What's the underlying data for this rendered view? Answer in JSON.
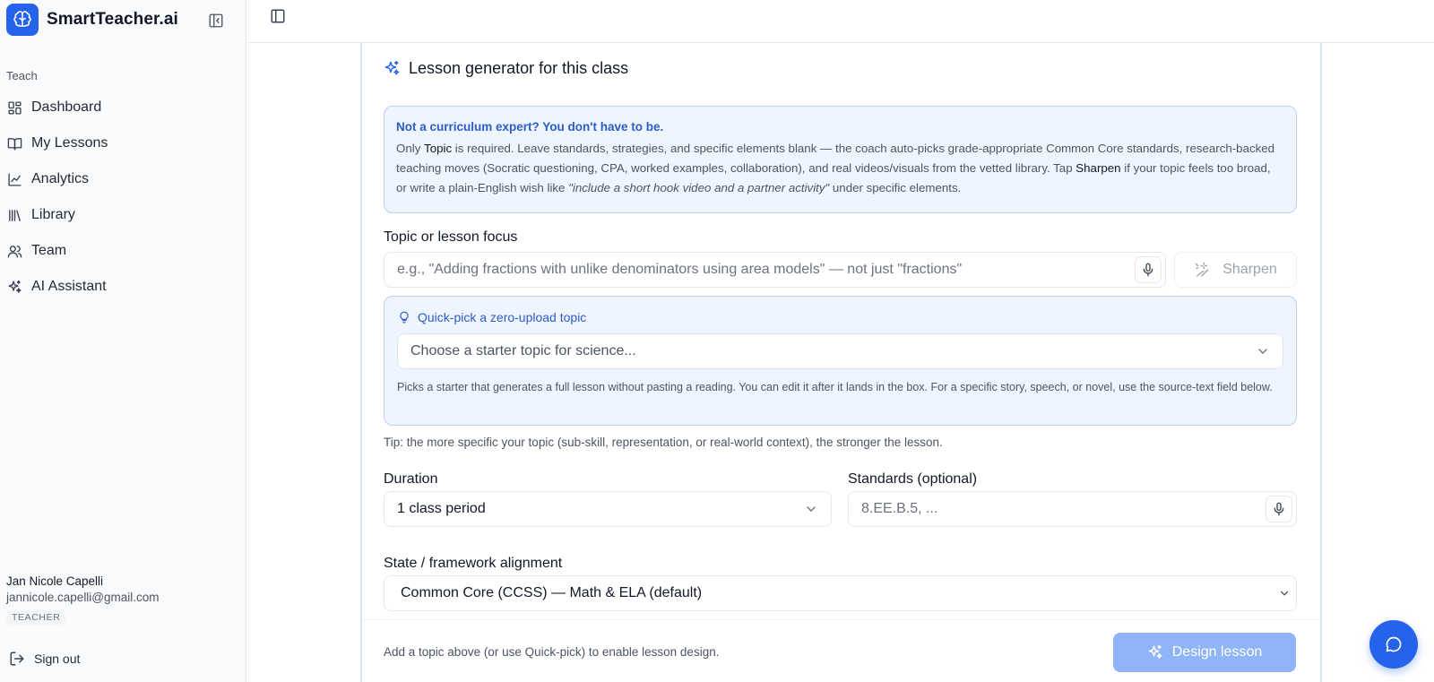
{
  "app": {
    "name": "SmartTeacher.ai",
    "brand_color": "#2563eb"
  },
  "sidebar": {
    "section_label": "Teach",
    "items": [
      {
        "label": "Dashboard",
        "icon": "dashboard-icon"
      },
      {
        "label": "My Lessons",
        "icon": "book-open-icon"
      },
      {
        "label": "Analytics",
        "icon": "line-chart-icon"
      },
      {
        "label": "Library",
        "icon": "library-icon"
      },
      {
        "label": "Team",
        "icon": "users-icon"
      },
      {
        "label": "AI Assistant",
        "icon": "sparkles-icon"
      }
    ],
    "user": {
      "name": "Jan Nicole Capelli",
      "email": "jannicole.capelli@gmail.com",
      "role": "TEACHER"
    },
    "sign_out": "Sign out"
  },
  "generator": {
    "title": "Lesson generator for this class",
    "info": {
      "title": "Not a curriculum expert? You don't have to be.",
      "p1": "Only ",
      "b1": "Topic",
      "p2": " is required. Leave standards, strategies, and specific elements blank — the coach auto-picks grade-appropriate Common Core standards, research-backed teaching moves (Socratic questioning, CPA, worked examples, collaboration), and real videos/visuals from the vetted library. Tap ",
      "b2": "Sharpen",
      "p3": " if your topic feels too broad, or write a plain-English wish like ",
      "i1": "\"include a short hook video and a partner activity\"",
      "p4": " under specific elements."
    },
    "topic": {
      "label": "Topic or lesson focus",
      "placeholder": "e.g., \"Adding fractions with unlike denominators using area models\" — not just \"fractions\"",
      "sharpen_label": "Sharpen"
    },
    "quick_pick": {
      "title": "Quick-pick a zero-upload topic",
      "select_placeholder": "Choose a starter topic for science...",
      "help": "Picks a starter that generates a full lesson without pasting a reading. You can edit it after it lands in the box. For a specific story, speech, or novel, use the source-text field below."
    },
    "tip": "Tip: the more specific your topic (sub-skill, representation, or real-world context), the stronger the lesson.",
    "duration": {
      "label": "Duration",
      "value": "1 class period"
    },
    "standards": {
      "label": "Standards (optional)",
      "placeholder": "8.EE.B.5, ..."
    },
    "framework": {
      "label": "State / framework alignment",
      "value": "Common Core (CCSS) — Math & ELA (default)"
    },
    "footer": {
      "hint": "Add a topic above (or use Quick-pick) to enable lesson design.",
      "design_label": "Design lesson"
    }
  }
}
